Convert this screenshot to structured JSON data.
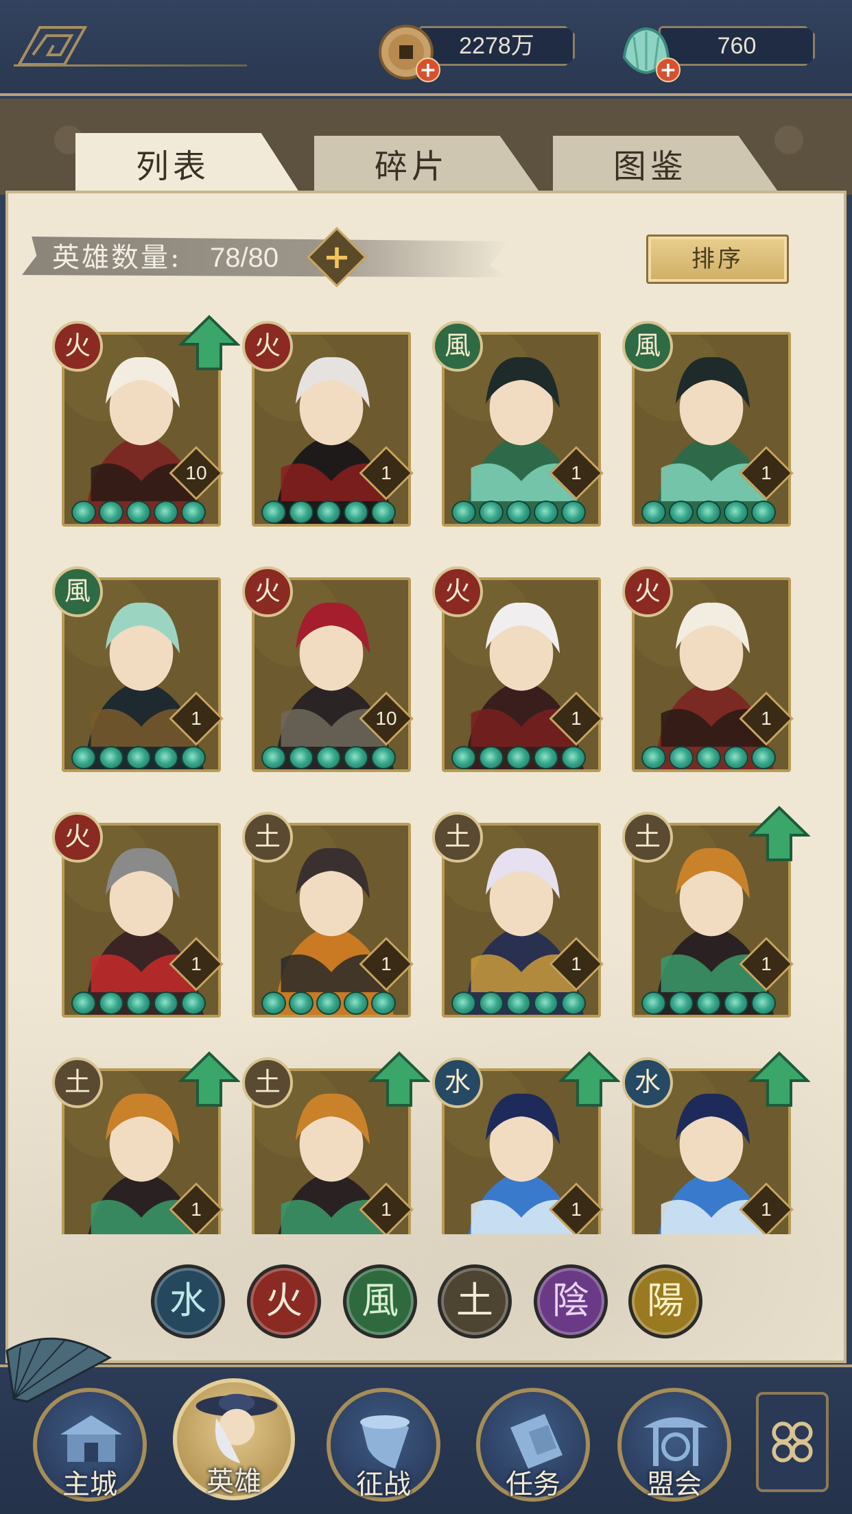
{
  "currency": {
    "coins": "2278万",
    "jade": "760"
  },
  "tabs": [
    {
      "label": "列表",
      "active": true
    },
    {
      "label": "碎片",
      "active": false
    },
    {
      "label": "图鉴",
      "active": false
    }
  ],
  "hero_count": {
    "label": "英雄数量:",
    "value": "78/80"
  },
  "sort_label": "排序",
  "element_glyphs": {
    "fire": "火",
    "wind": "風",
    "earth": "土",
    "water": "水",
    "yin": "陰",
    "yang": "陽"
  },
  "heroes": [
    {
      "element": "火",
      "level": "10",
      "upgrade": true,
      "palette": [
        "#7a2a22",
        "#f3ece0",
        "#2a1a14"
      ]
    },
    {
      "element": "火",
      "level": "1",
      "upgrade": false,
      "palette": [
        "#1e1a1a",
        "#e6e2e0",
        "#8a1e1e"
      ]
    },
    {
      "element": "風",
      "level": "1",
      "upgrade": false,
      "palette": [
        "#2e6a4a",
        "#1f2a2a",
        "#7fd3b8"
      ]
    },
    {
      "element": "風",
      "level": "1",
      "upgrade": false,
      "palette": [
        "#2e6a4a",
        "#1f2a2a",
        "#7fd3b8"
      ]
    },
    {
      "element": "風",
      "level": "1",
      "upgrade": false,
      "palette": [
        "#1f2a30",
        "#9cd4c2",
        "#7a5a2a"
      ]
    },
    {
      "element": "火",
      "level": "10",
      "upgrade": false,
      "palette": [
        "#2a2424",
        "#a41e2e",
        "#6e6a5a"
      ]
    },
    {
      "element": "火",
      "level": "1",
      "upgrade": false,
      "palette": [
        "#3a1e1e",
        "#f0eeee",
        "#7a2020"
      ]
    },
    {
      "element": "火",
      "level": "1",
      "upgrade": false,
      "palette": [
        "#7a2a22",
        "#f3ece0",
        "#2a1a14"
      ]
    },
    {
      "element": "火",
      "level": "1",
      "upgrade": false,
      "palette": [
        "#3a2424",
        "#8a8a8a",
        "#c82a2a"
      ]
    },
    {
      "element": "土",
      "level": "1",
      "upgrade": false,
      "palette": [
        "#c97a22",
        "#3a3030",
        "#2a2a2a"
      ]
    },
    {
      "element": "土",
      "level": "1",
      "upgrade": false,
      "palette": [
        "#2a3050",
        "#e6e0f0",
        "#c99a3a"
      ]
    },
    {
      "element": "土",
      "level": "1",
      "upgrade": true,
      "palette": [
        "#2a2222",
        "#c9822a",
        "#3a9a6a"
      ]
    },
    {
      "element": "土",
      "level": "1",
      "upgrade": true,
      "palette": [
        "#2a2222",
        "#c9822a",
        "#3a9a6a"
      ]
    },
    {
      "element": "土",
      "level": "1",
      "upgrade": true,
      "palette": [
        "#2a2222",
        "#c9822a",
        "#3a9a6a"
      ]
    },
    {
      "element": "水",
      "level": "1",
      "upgrade": true,
      "palette": [
        "#3a7acc",
        "#1e2a5a",
        "#e0eef8"
      ]
    },
    {
      "element": "水",
      "level": "1",
      "upgrade": true,
      "palette": [
        "#3a7acc",
        "#1e2a5a",
        "#e0eef8"
      ]
    }
  ],
  "nav": [
    {
      "label": "主城",
      "icon": "city-gate-icon"
    },
    {
      "label": "英雄",
      "icon": "hero-portrait-icon",
      "active": true
    },
    {
      "label": "征战",
      "icon": "war-horn-icon"
    },
    {
      "label": "任务",
      "icon": "scroll-icon"
    },
    {
      "label": "盟会",
      "icon": "pavilion-icon"
    }
  ],
  "colors": {
    "accent_gold": "#b89b58",
    "panel": "#efe7d4",
    "navy": "#2f3f5a"
  }
}
